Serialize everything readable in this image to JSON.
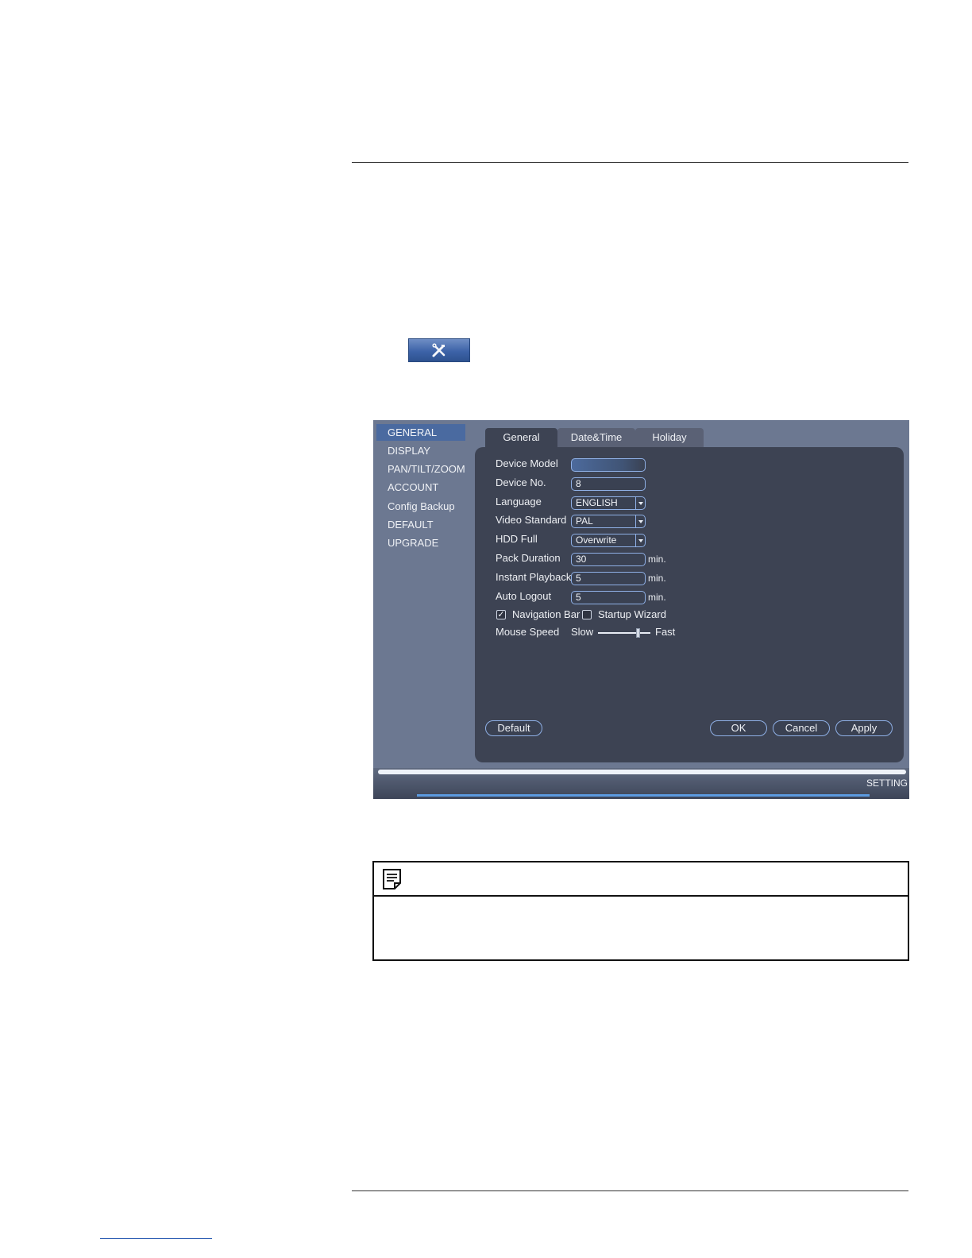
{
  "sidebar": {
    "items": [
      {
        "label": "GENERAL",
        "active": true
      },
      {
        "label": "DISPLAY"
      },
      {
        "label": "PAN/TILT/ZOOM"
      },
      {
        "label": "ACCOUNT"
      },
      {
        "label": "Config Backup"
      },
      {
        "label": "DEFAULT"
      },
      {
        "label": "UPGRADE"
      }
    ]
  },
  "tabs": [
    {
      "label": "General",
      "active": true
    },
    {
      "label": "Date&Time"
    },
    {
      "label": "Holiday"
    }
  ],
  "form": {
    "device_model": {
      "label": "Device Model",
      "value": ""
    },
    "device_no": {
      "label": "Device No.",
      "value": "8"
    },
    "language": {
      "label": "Language",
      "value": "ENGLISH"
    },
    "video_standard": {
      "label": "Video Standard",
      "value": "PAL"
    },
    "hdd_full": {
      "label": "HDD Full",
      "value": "Overwrite"
    },
    "pack_duration": {
      "label": "Pack Duration",
      "value": "30",
      "unit": "min."
    },
    "instant_playback": {
      "label": "Instant Playback",
      "value": "5",
      "unit": "min."
    },
    "auto_logout": {
      "label": "Auto Logout",
      "value": "5",
      "unit": "min."
    },
    "navigation_bar": {
      "label": "Navigation Bar",
      "checked": true
    },
    "startup_wizard": {
      "label": "Startup Wizard",
      "checked": false
    },
    "mouse_speed": {
      "label": "Mouse Speed",
      "min_label": "Slow",
      "max_label": "Fast",
      "level": 0.75
    }
  },
  "buttons": {
    "default": "Default",
    "ok": "OK",
    "cancel": "Cancel",
    "apply": "Apply"
  },
  "status": {
    "text": "SETTING"
  },
  "icons": {
    "toolbar": "tools-icon",
    "note": "note-icon",
    "check": "checkmark-icon"
  },
  "colors": {
    "dvr_bg": "#6c7891",
    "panel_bg": "#3d4353",
    "accent": "#4a6aa0",
    "field_border": "#8fb0e6"
  }
}
